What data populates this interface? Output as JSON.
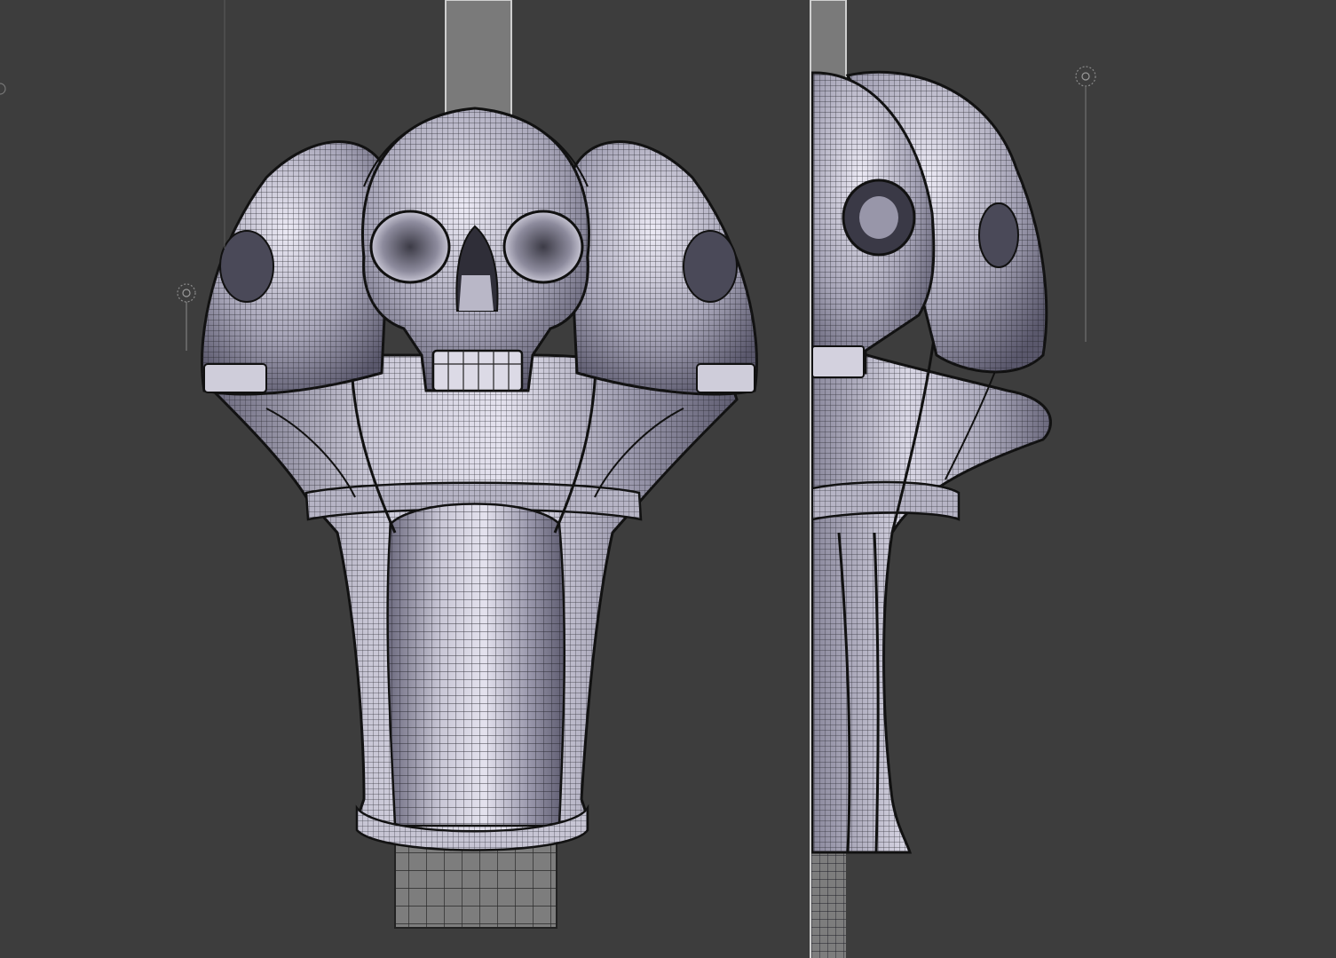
{
  "viewports": [
    {
      "name": "front-view"
    },
    {
      "name": "side-view"
    }
  ],
  "model": {
    "object": "skull-cane-handle",
    "skull_count": 3,
    "display_mode": "wireframe-over-solid"
  },
  "colors": {
    "background": "#3d3d3d",
    "shaft": "#7a7a7a",
    "mesh_light": "#d9d7e4",
    "mesh_mid": "#9a98aa",
    "mesh_dark": "#58566a",
    "wire": "#1f1f26",
    "empty_marker": "#8a8a8a"
  },
  "icons": [
    "empty-axis-icon"
  ]
}
